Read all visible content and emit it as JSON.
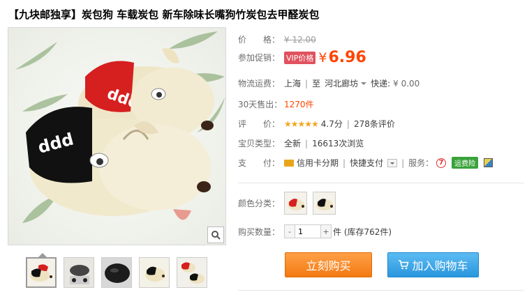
{
  "title": "【九块邮独享】炭包狗 车载炭包 新车除味长嘴狗竹炭包去甲醛炭包",
  "price": {
    "label": "价　　格：",
    "original": "¥ 12.00"
  },
  "promo": {
    "label": "参加促销：",
    "tag": "VIP价格",
    "currency": "¥",
    "value": "6.96"
  },
  "shipping": {
    "label": "物流运费：",
    "origin": "上海",
    "to": "至",
    "destination": "河北廊坊",
    "method": "快递:",
    "cost": "¥ 0.00"
  },
  "sales": {
    "label": "30天售出：",
    "count": "1270件"
  },
  "rating": {
    "label": "评　　价：",
    "stars": "★★★★★",
    "score": "4.7分",
    "reviews": "278条评价"
  },
  "item_type": {
    "label": "宝贝类型：",
    "condition": "全新",
    "views": "16613次浏览"
  },
  "payment": {
    "label": "支　　付：",
    "credit": "信用卡分期",
    "quick": "快捷支付",
    "service_label": "服务：",
    "service_icon_text": "7",
    "service_badge": "运费险"
  },
  "color": {
    "label": "颜色分类："
  },
  "quantity": {
    "label": "购买数量：",
    "value": "1",
    "minus": "-",
    "plus": "+",
    "stock": "件 (库存762件)"
  },
  "buttons": {
    "buy": "立刻购买",
    "cart": "加入购物车"
  },
  "colors": {
    "price_orange": "#ff4400",
    "vip_tag": "#e0525e",
    "buy_button": "#f27a12",
    "cart_button": "#2a96dd",
    "badge_green": "#3aa23a"
  },
  "icons": {
    "zoom": "magnifier-icon",
    "cart": "cart-icon",
    "credit_card": "credit-card-icon",
    "service_7day": "seven-day-return-icon",
    "service_extra": "service-extra-icon"
  }
}
